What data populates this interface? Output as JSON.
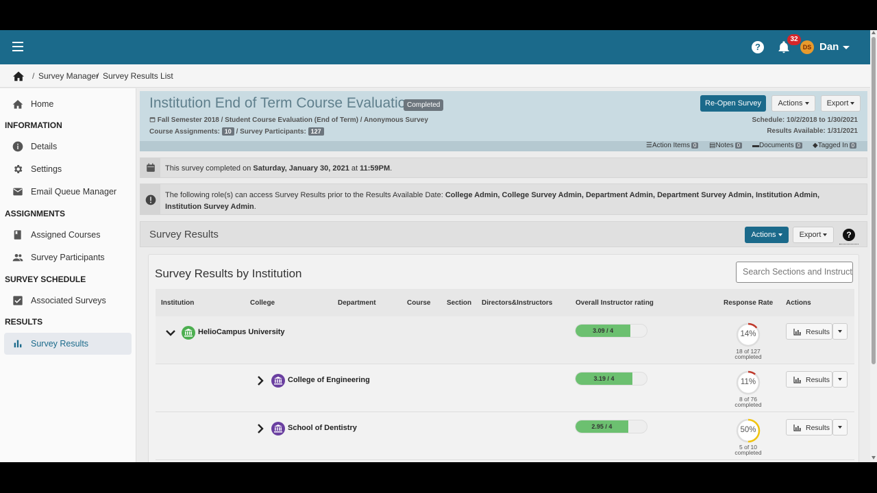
{
  "topbar": {
    "help_icon": "question-circle-icon",
    "notification_count": "32",
    "avatar_initials": "DS",
    "user_name": "Dan"
  },
  "breadcrumb": {
    "items": [
      "Survey Manager",
      "Survey Results List"
    ],
    "separator": "/"
  },
  "sidebar": {
    "home": "Home",
    "sections": [
      {
        "heading": "INFORMATION",
        "items": [
          "Details",
          "Settings",
          "Email Queue Manager"
        ]
      },
      {
        "heading": "ASSIGNMENTS",
        "items": [
          "Assigned Courses",
          "Survey Participants"
        ]
      },
      {
        "heading": "SURVEY SCHEDULE",
        "items": [
          "Associated Surveys"
        ]
      },
      {
        "heading": "RESULTS",
        "items": [
          "Survey Results"
        ]
      }
    ]
  },
  "survey": {
    "title": "Institution End of Term Course Evaluation",
    "status": "Completed",
    "meta_line1": "Fall Semester 2018 / Student Course Evaluation  (End of Term)  / Anonymous Survey",
    "course_assignments_label": "Course Assignments:",
    "course_assignments_count": "10",
    "participants_label": "/ Survey Participants:",
    "participants_count": "127",
    "schedule": "Schedule: 10/2/2018 to 1/30/2021",
    "results_available": "Results Available: 1/31/2021",
    "reopen_label": "Re-Open Survey",
    "actions_label": "Actions",
    "export_label": "Export",
    "tools": [
      {
        "label": "Action Items",
        "count": "0"
      },
      {
        "label": "Notes",
        "count": "0"
      },
      {
        "label": "Documents",
        "count": "0"
      },
      {
        "label": "Tagged In",
        "count": "0"
      }
    ]
  },
  "alerts": {
    "completed_prefix": "This survey completed on ",
    "completed_date": "Saturday, January 30, 2021",
    "completed_mid": " at ",
    "completed_time": "11:59PM",
    "completed_suffix": ".",
    "roles_prefix": "The following role(s) can access Survey Results prior to the Results Available Date: ",
    "roles_list": "College Admin, College Survey Admin, Department Admin, Department Survey Admin, Institution Admin, Institution Survey Admin",
    "roles_suffix": "."
  },
  "results_section": {
    "title": "Survey Results",
    "actions_label": "Actions",
    "export_label": "Export",
    "help": "?"
  },
  "results_card": {
    "title": "Survey Results by Institution",
    "search_placeholder": "Search Sections and Instructors",
    "columns": [
      "Institution",
      "College",
      "Department",
      "Course",
      "Section",
      "Directors&Instructors",
      "Overall Instructor rating",
      "Response Rate",
      "Actions"
    ],
    "rows": [
      {
        "name": "HelioCampus University",
        "rating": "3.09 / 4",
        "rating_frac": 0.7725,
        "pct": "14%",
        "pct_value": 0.14,
        "count": "18 of 127",
        "completed": "completed",
        "btn": "Results",
        "ring_color": "#c0392b",
        "icon_color": "#4caf50"
      },
      {
        "name": "College of Engineering",
        "rating": "3.19 / 4",
        "rating_frac": 0.7975,
        "pct": "11%",
        "pct_value": 0.11,
        "count": "8 of 76",
        "completed": "completed",
        "btn": "Results",
        "ring_color": "#c0392b",
        "icon_color": "#6a3fa0"
      },
      {
        "name": "School of Dentistry",
        "rating": "2.95 / 4",
        "rating_frac": 0.7375,
        "pct": "50%",
        "pct_value": 0.5,
        "count": "5 of 10",
        "completed": "completed",
        "btn": "Results",
        "ring_color": "#f1c40f",
        "icon_color": "#6a3fa0"
      }
    ]
  }
}
